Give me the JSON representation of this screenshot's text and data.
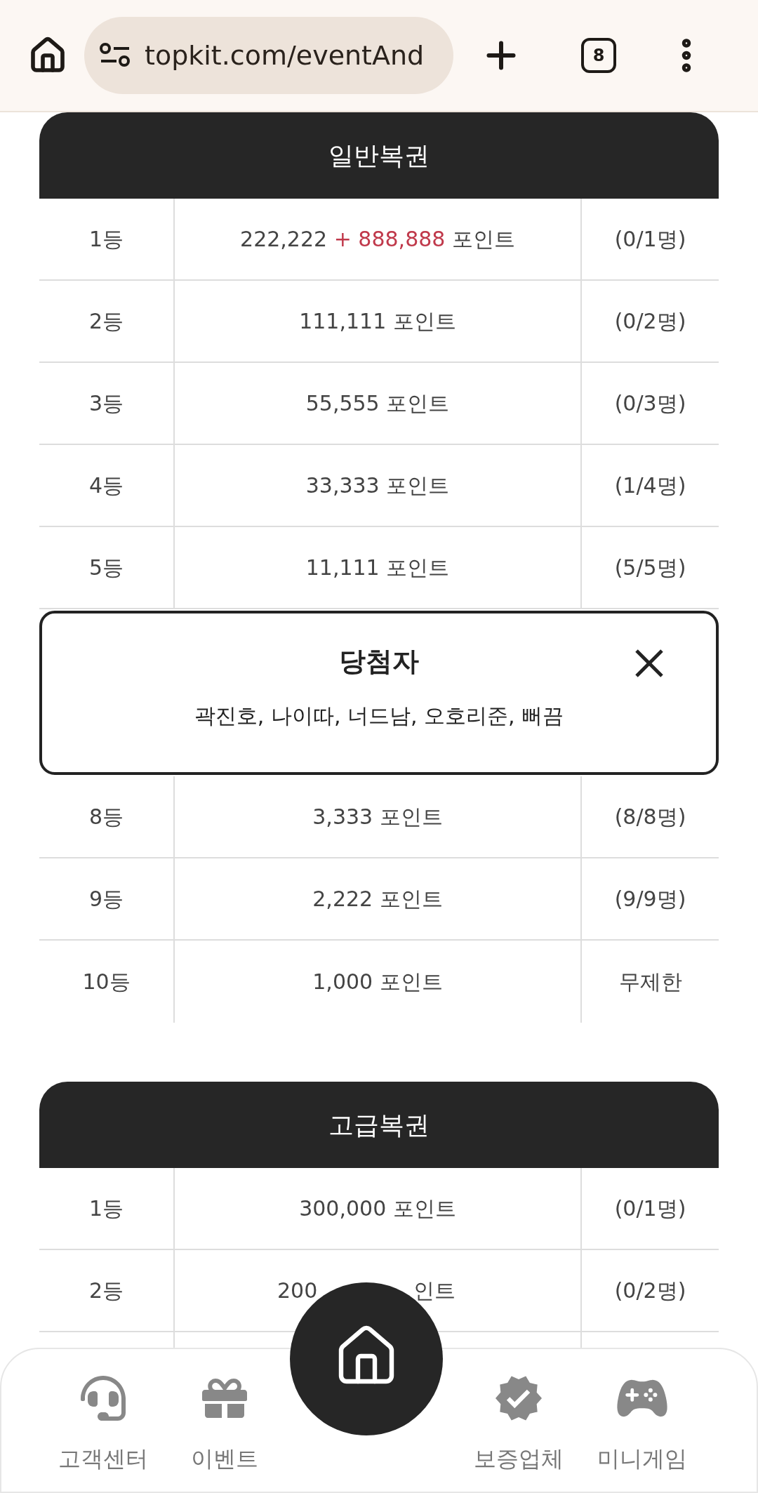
{
  "browser": {
    "url": "topkit.com/eventAnd",
    "tab_count": "8"
  },
  "tables": [
    {
      "title": "일반복권",
      "rows_before": [
        {
          "rank": "1등",
          "amount": "222,222",
          "bonus": "+ 888,888",
          "unit": "포인트",
          "count": "(0/1명)"
        },
        {
          "rank": "2등",
          "amount": "111,111",
          "unit": "포인트",
          "count": "(0/2명)"
        },
        {
          "rank": "3등",
          "amount": "55,555",
          "unit": "포인트",
          "count": "(0/3명)"
        },
        {
          "rank": "4등",
          "amount": "33,333",
          "unit": "포인트",
          "count": "(1/4명)"
        },
        {
          "rank": "5등",
          "amount": "11,111",
          "unit": "포인트",
          "count": "(5/5명)"
        }
      ],
      "popup": {
        "title": "당첨자",
        "winners": "곽진호, 나이따, 너드남, 오호리준, 뻐끔"
      },
      "rows_after": [
        {
          "rank": "8등",
          "amount": "3,333",
          "unit": "포인트",
          "count": "(8/8명)"
        },
        {
          "rank": "9등",
          "amount": "2,222",
          "unit": "포인트",
          "count": "(9/9명)"
        },
        {
          "rank": "10등",
          "amount": "1,000",
          "unit": "포인트",
          "count": "무제한"
        }
      ]
    },
    {
      "title": "고급복권",
      "rows_before": [
        {
          "rank": "1등",
          "amount": "300,000",
          "unit": "포인트",
          "count": "(0/1명)"
        },
        {
          "rank": "2등",
          "kind": "covered",
          "amount": "200",
          "unit": "인트",
          "count": "(0/2명)"
        }
      ]
    }
  ],
  "bottom_nav": [
    {
      "kind": "support",
      "label": "고객센터"
    },
    {
      "kind": "event",
      "label": "이벤트"
    },
    {
      "kind": "home"
    },
    {
      "kind": "verified",
      "label": "보증업체"
    },
    {
      "kind": "game",
      "label": "미니게임"
    }
  ]
}
